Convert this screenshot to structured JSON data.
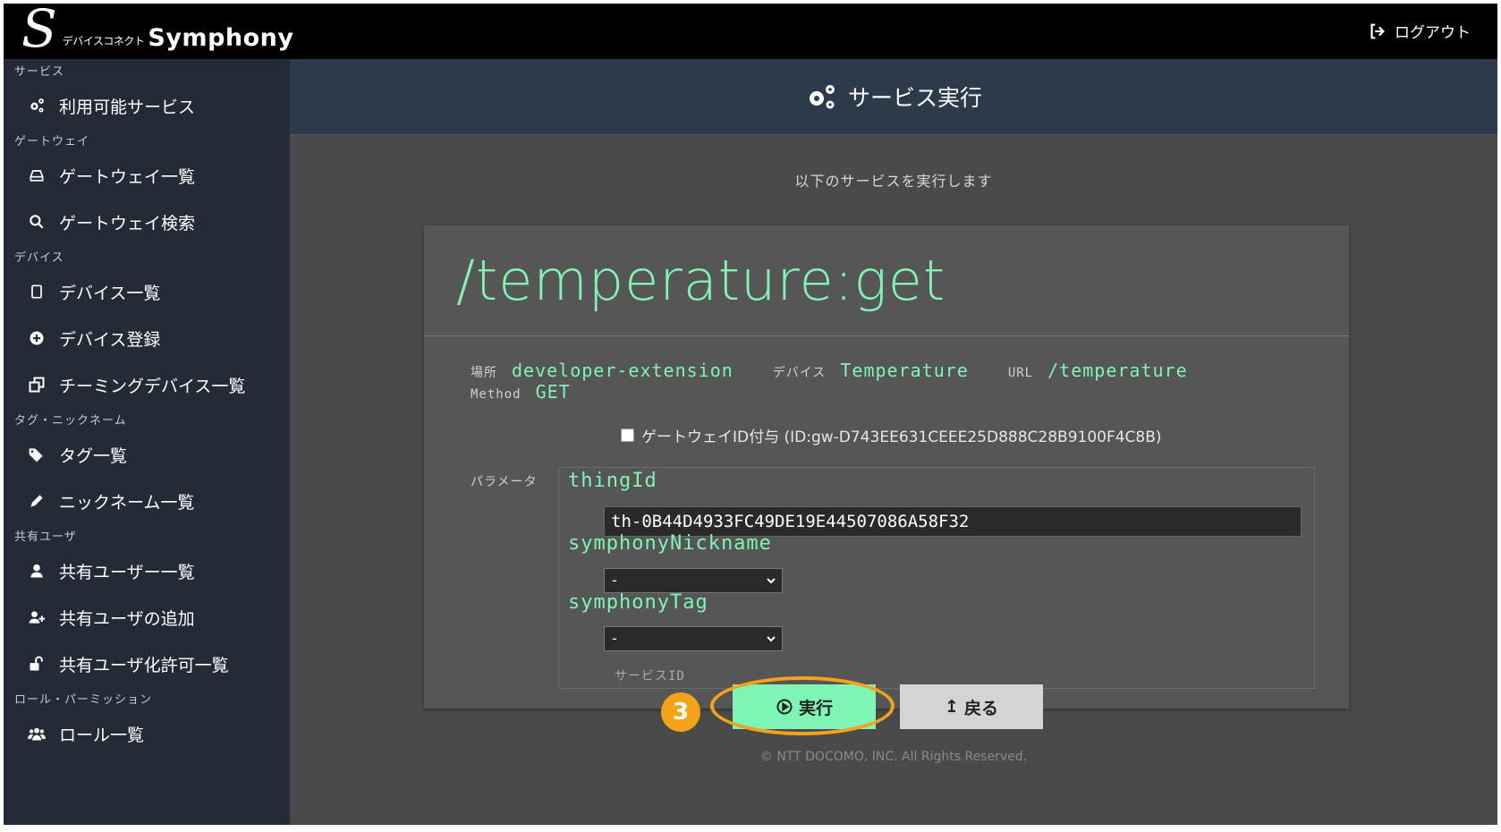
{
  "header": {
    "logo_sub": "デバイスコネクト",
    "logo_main": "Symphony",
    "logout_label": "ログアウト"
  },
  "sidebar": {
    "sections": [
      {
        "title": "サービス",
        "items": [
          {
            "label": "利用可能サービス",
            "icon": "gears-icon"
          }
        ]
      },
      {
        "title": "ゲートウェイ",
        "items": [
          {
            "label": "ゲートウェイ一覧",
            "icon": "drive-icon"
          },
          {
            "label": "ゲートウェイ検索",
            "icon": "search-icon"
          }
        ]
      },
      {
        "title": "デバイス",
        "items": [
          {
            "label": "デバイス一覧",
            "icon": "tablet-icon"
          },
          {
            "label": "デバイス登録",
            "icon": "plus-circle-icon"
          },
          {
            "label": "チーミングデバイス一覧",
            "icon": "clone-icon"
          }
        ]
      },
      {
        "title": "タグ・ニックネーム",
        "items": [
          {
            "label": "タグ一覧",
            "icon": "tags-icon"
          },
          {
            "label": "ニックネーム一覧",
            "icon": "pencil-icon"
          }
        ]
      },
      {
        "title": "共有ユーザ",
        "items": [
          {
            "label": "共有ユーザー一覧",
            "icon": "user-icon"
          },
          {
            "label": "共有ユーザの追加",
            "icon": "user-plus-icon"
          },
          {
            "label": "共有ユーザ化許可一覧",
            "icon": "unlock-icon"
          }
        ]
      },
      {
        "title": "ロール・パーミッション",
        "items": [
          {
            "label": "ロール一覧",
            "icon": "users-icon"
          }
        ]
      }
    ]
  },
  "main": {
    "page_title": "サービス実行",
    "subtitle": "以下のサービスを実行します",
    "service_name": "/temperature:get",
    "meta": {
      "location_label": "場所",
      "location_value": "developer-extension",
      "device_label": "デバイス",
      "device_value": "Temperature",
      "url_label": "URL",
      "url_value": "/temperature",
      "method_label": "Method",
      "method_value": "GET"
    },
    "gateway_checkbox_label": "ゲートウェイID付与 (ID:gw-D743EE631CEEE25D888C28B9100F4C8B)",
    "params_label": "パラメータ",
    "params": {
      "thing_id_name": "thingId",
      "thing_id_value": "th-0B44D4933FC49DE19E44507086A58F32",
      "nickname_name": "symphonyNickname",
      "nickname_value": "-",
      "tag_name": "symphonyTag",
      "tag_value": "-",
      "service_id_label": "サービスID"
    },
    "step_number": "3",
    "run_label": "実行",
    "back_label": "戻る",
    "copyright": "© NTT DOCOMO, INC. All Rights Reserved."
  },
  "colors": {
    "accent_green": "#7ef5b4",
    "highlight_orange": "#f3a21a",
    "sidebar_bg": "#232b36"
  }
}
